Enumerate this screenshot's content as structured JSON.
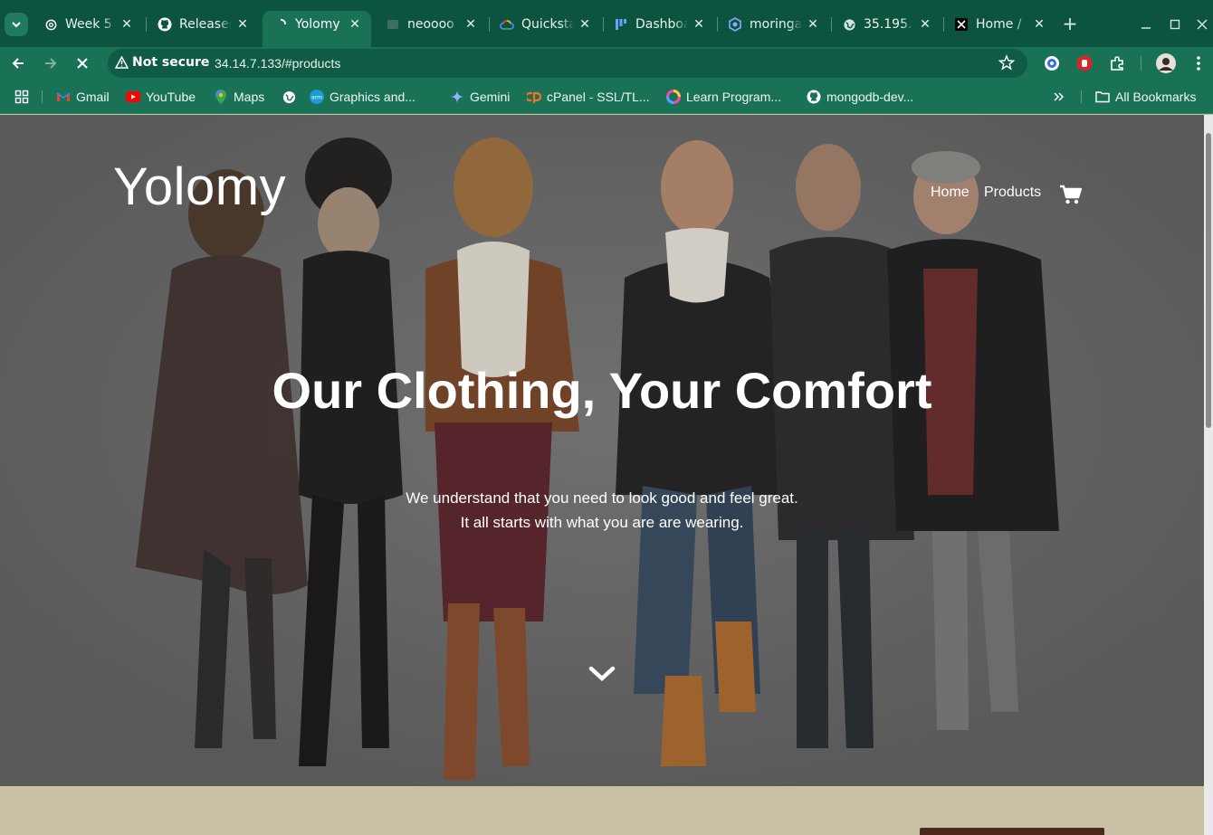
{
  "tabs": [
    {
      "title": "Week 5",
      "icon": "openai-icon",
      "active": false
    },
    {
      "title": "Releases",
      "icon": "github-icon",
      "active": false
    },
    {
      "title": "Yolomy",
      "icon": "loading-icon",
      "active": true
    },
    {
      "title": "neoooo",
      "icon": "site-icon",
      "active": false
    },
    {
      "title": "Quickstart",
      "icon": "google-cloud-icon",
      "active": false
    },
    {
      "title": "Dashboard",
      "icon": "dashboard-icon",
      "active": false
    },
    {
      "title": "moringa",
      "icon": "hexagon-icon",
      "active": false
    },
    {
      "title": "35.195.",
      "icon": "globe-icon",
      "active": false
    },
    {
      "title": "Home /",
      "icon": "x-icon",
      "active": false
    }
  ],
  "toolbar": {
    "security_label": "Not secure",
    "url": "34.14.7.133/#products"
  },
  "bookmarks": [
    {
      "label": "Gmail",
      "icon": "gmail-icon"
    },
    {
      "label": "YouTube",
      "icon": "youtube-icon"
    },
    {
      "label": "Maps",
      "icon": "maps-icon"
    },
    {
      "label": "",
      "icon": "globe-icon"
    },
    {
      "label": "Graphics and...",
      "icon": "arm-icon"
    },
    {
      "label": "Gemini",
      "icon": "gemini-icon"
    },
    {
      "label": "cPanel - SSL/TL...",
      "icon": "cpanel-icon"
    },
    {
      "label": "Learn Program...",
      "icon": "learn-icon"
    },
    {
      "label": "mongodb-dev...",
      "icon": "github-icon"
    }
  ],
  "all_bookmarks_label": "All Bookmarks",
  "site": {
    "brand": "Yolomy",
    "nav": {
      "home": "Home",
      "products": "Products"
    },
    "headline": "Our Clothing, Your Comfort",
    "subline_1": "We understand that you need to look good and feel great.",
    "subline_2": "It all starts with what you are are wearing."
  }
}
